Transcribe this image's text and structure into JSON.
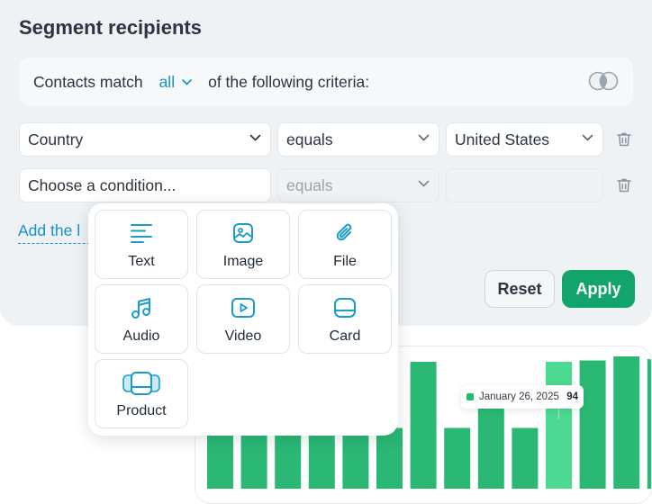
{
  "panel": {
    "title": "Segment recipients",
    "criteria": {
      "prefix": "Contacts match",
      "match_value": "all",
      "suffix": "of the following criteria:"
    },
    "rows": [
      {
        "field": "Country",
        "operator": "equals",
        "value": "United States"
      },
      {
        "field_placeholder": "Choose a condition...",
        "operator": "equals",
        "value": ""
      }
    ],
    "add_link": "Add the l",
    "reset_label": "Reset",
    "apply_label": "Apply"
  },
  "popup": {
    "items": [
      {
        "label": "Text",
        "icon": "text-align-icon"
      },
      {
        "label": "Image",
        "icon": "image-icon"
      },
      {
        "label": "File",
        "icon": "paperclip-icon"
      },
      {
        "label": "Audio",
        "icon": "music-note-icon"
      },
      {
        "label": "Video",
        "icon": "play-icon"
      },
      {
        "label": "Card",
        "icon": "card-icon"
      },
      {
        "label": "Product",
        "icon": "carousel-icon"
      }
    ]
  },
  "chart_data": {
    "type": "bar",
    "values": [
      45,
      45,
      45,
      45,
      45,
      45,
      94,
      45,
      70,
      45,
      94,
      95,
      98,
      96
    ],
    "highlighted_index": 10,
    "tooltip": {
      "label": "January 26, 2025",
      "value": "94"
    },
    "colors": {
      "bar": "#2ab874",
      "highlight": "#4cd991",
      "hover": "#22c06e"
    }
  },
  "colors": {
    "accent": "#1392c9",
    "primary_button": "#11a56b"
  }
}
